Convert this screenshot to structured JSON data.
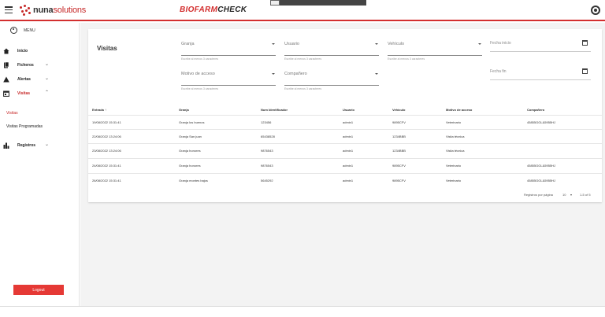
{
  "header": {
    "logo_main": "nuna",
    "logo_light": "solutions",
    "brand_part1": "BIOFARM",
    "brand_part2": "CHECK"
  },
  "sidebar": {
    "menu_label": "MENU",
    "items": [
      {
        "label": "Inicio",
        "icon": "home-icon"
      },
      {
        "label": "Ficheros",
        "icon": "file-icon"
      },
      {
        "label": "Alertas",
        "icon": "warning-icon"
      },
      {
        "label": "Visitas",
        "icon": "calendar-icon"
      }
    ],
    "sub_items": [
      {
        "label": "Visitas",
        "active": true
      },
      {
        "label": "Visitas Programadas",
        "active": false
      }
    ],
    "registros": {
      "label": "Registros",
      "icon": "bar-chart-icon"
    },
    "logout_label": "Logout"
  },
  "card": {
    "title": "Visitas",
    "filters": {
      "granja": {
        "placeholder": "Granja",
        "hint": "Escribe al menos 3 caracteres"
      },
      "usuario": {
        "placeholder": "Usuario",
        "hint": "Escribe al menos 3 caracteres"
      },
      "vehiculo": {
        "placeholder": "Vehículo",
        "hint": "Escribe al menos 3 caracteres"
      },
      "fecha_inicio": {
        "placeholder": "Fecha inicio"
      },
      "motivo": {
        "placeholder": "Motivo de acceso",
        "hint": "Escribe al menos 3 caracteres"
      },
      "companero": {
        "placeholder": "Compañero",
        "hint": "Escribe al menos 3 caracteres"
      },
      "fecha_fin": {
        "placeholder": "Fecha fin"
      }
    },
    "table": {
      "columns": [
        "Entrada ↑",
        "Granja",
        "Num Identificador",
        "Usuario",
        "Vehículo",
        "Motivo de acceso",
        "Compañero"
      ],
      "rows": [
        [
          "19/08/2022 15:31:41",
          "Granja los buenos",
          "123456",
          "admin1",
          "9895CFV",
          "Veterinario",
          "45855GGL&5955HJ"
        ],
        [
          "22/08/2022 13:24:06",
          "Granja San juan",
          "65438528",
          "admin1",
          "1234BBB",
          "Visita técnica",
          ""
        ],
        [
          "23/08/2022 13:24:06",
          "Granja honores",
          "9876543",
          "admin1",
          "1234BBB",
          "Visita técnica",
          ""
        ],
        [
          "24/08/2022 15:31:41",
          "Granja honores",
          "9876543",
          "admin1",
          "9895CFV",
          "Veterinario",
          "45855GGL&5955HJ"
        ],
        [
          "26/08/2022 15:31:41",
          "Granja montes bajos",
          "5645292",
          "admin1",
          "9895CFV",
          "Veterinario",
          "45855GGL&5955HJ"
        ]
      ]
    },
    "pagination": {
      "rows_per_page_label": "Registros por página",
      "rows_per_page_value": "10",
      "range": "1-5 of 5"
    }
  },
  "colors": {
    "accent": "#d32f2f",
    "logout": "#e53935"
  }
}
